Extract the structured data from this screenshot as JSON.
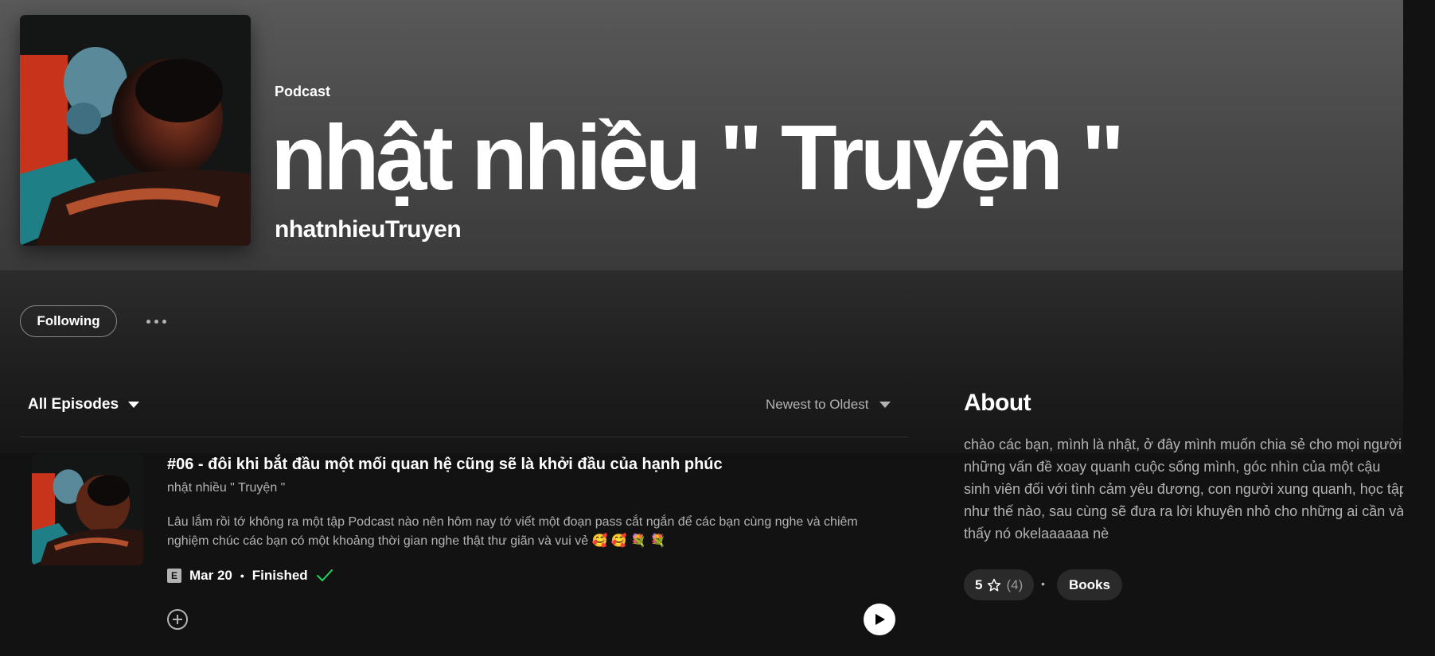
{
  "hero": {
    "type_label": "Podcast",
    "title": "nhật nhiều \" Truyện \"",
    "author": "nhatnhieuTruyen"
  },
  "actions": {
    "follow_label": "Following"
  },
  "episodes_header": {
    "filter_label": "All Episodes",
    "sort_label": "Newest to Oldest"
  },
  "episode": {
    "title": "#06 - đôi khi bắt đầu một mối quan hệ cũng sẽ là khởi đầu của hạnh phúc",
    "show": "nhật nhiều \" Truyện \"",
    "description": "Lâu lắm rồi tớ không ra một tập Podcast nào nên hôm nay tớ viết một đoạn pass cắt ngắn để các bạn cùng nghe và chiêm nghiệm chúc các bạn có một khoảng thời gian nghe thật thư giãn và vui vẻ 🥰 🥰 💐 💐",
    "explicit_label": "E",
    "date": "Mar 20",
    "separator": "•",
    "status": "Finished",
    "status_color": "#1ed760"
  },
  "about": {
    "title": "About",
    "text": "chào các bạn, mình là nhật, ở đây mình muốn chia sẻ cho mọi người những vấn đề xoay quanh cuộc sống mình, góc nhìn của một cậu sinh viên đối với tình cảm yêu đương, con người xung quanh, học tập như thế nào, sau cùng sẽ đưa ra lời khuyên nhỏ cho những ai cần và thấy nó okelaaaaaa nè",
    "rating": "5",
    "rating_count": "(4)",
    "separator": "•",
    "category": "Books"
  },
  "icons": {
    "more": "more-options-icon",
    "add": "add-circle-icon",
    "play": "play-icon",
    "check": "check-icon",
    "star": "star-icon",
    "caret": "caret-down-icon"
  }
}
